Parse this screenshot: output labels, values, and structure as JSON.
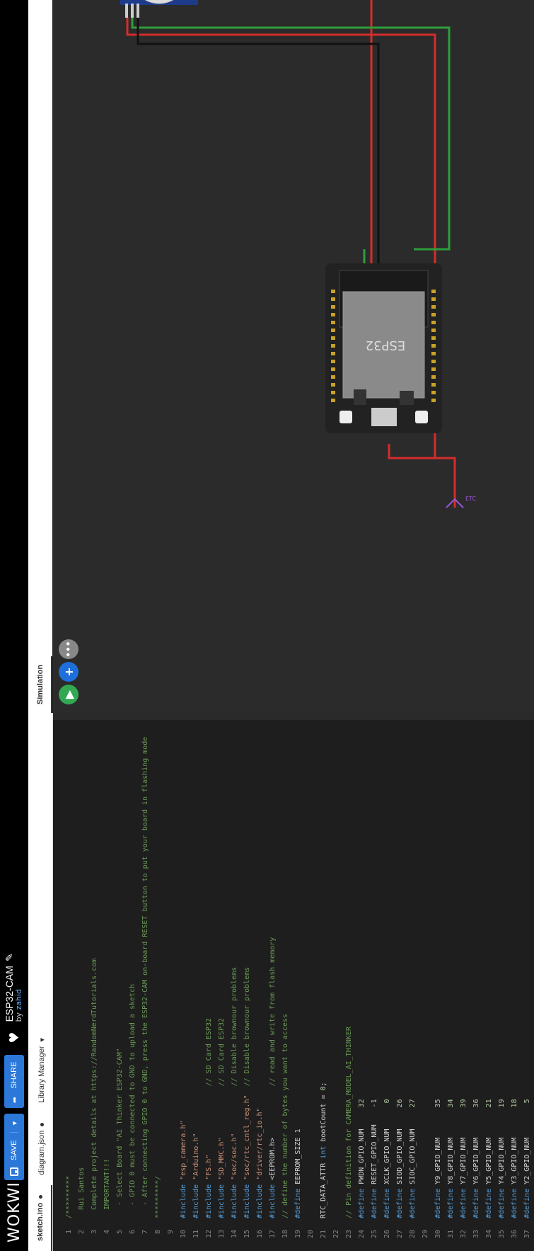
{
  "header": {
    "logo": "WOKWI",
    "save_label": "SAVE",
    "share_label": "SHARE",
    "project_title": "ESP32-CAM",
    "by_label": "by",
    "author": "zahid"
  },
  "tabs": [
    {
      "label": "sketch.ino"
    },
    {
      "label": "diagram.json"
    },
    {
      "label": "Library Manager"
    }
  ],
  "simulation_tab": "Simulation",
  "chip_label": "ESP32",
  "code_lines": [
    {
      "n": "1",
      "html": "<span class='cm'>/*********</span>"
    },
    {
      "n": "2",
      "html": "<span class='cm'>  Rui Santos</span>"
    },
    {
      "n": "3",
      "html": "<span class='cm'>  Complete project details at https://RandomNerdTutorials.com</span>"
    },
    {
      "n": "4",
      "html": "<span class='cm'>  IMPORTANT!!!</span>"
    },
    {
      "n": "5",
      "html": "<span class='cm'>   - Select Board \"AI Thinker ESP32-CAM\"</span>"
    },
    {
      "n": "6",
      "html": "<span class='cm'>   - GPIO 0 must be connected to GND to upload a sketch</span>"
    },
    {
      "n": "7",
      "html": "<span class='cm'>   - After connecting GPIO 0 to GND, press the ESP32-CAM on-board RESET button to put your board in flashing mode</span>"
    },
    {
      "n": "8",
      "html": "<span class='cm'>*********/</span>"
    },
    {
      "n": "9",
      "html": ""
    },
    {
      "n": "10",
      "html": "<span class='kw'>#include</span> <span class='str'>\"esp_camera.h\"</span>"
    },
    {
      "n": "11",
      "html": "<span class='kw'>#include</span> <span class='str'>\"Arduino.h\"</span>"
    },
    {
      "n": "12",
      "html": "<span class='kw'>#include</span> <span class='str'>\"FS.h\"</span>                <span class='cm'>// SD Card ESP32</span>"
    },
    {
      "n": "13",
      "html": "<span class='kw'>#include</span> <span class='str'>\"SD_MMC.h\"</span>            <span class='cm'>// SD Card ESP32</span>"
    },
    {
      "n": "14",
      "html": "<span class='kw'>#include</span> <span class='str'>\"soc/soc.h\"</span>           <span class='cm'>// Disable brownour problems</span>"
    },
    {
      "n": "15",
      "html": "<span class='kw'>#include</span> <span class='str'>\"soc/rtc_cntl_reg.h\"</span>  <span class='cm'>// Disable brownour problems</span>"
    },
    {
      "n": "16",
      "html": "<span class='kw'>#include</span> <span class='str'>\"driver/rtc_io.h\"</span>"
    },
    {
      "n": "17",
      "html": "<span class='kw'>#include</span> <span class='tx'>&lt;EEPROM.h&gt;</span>            <span class='cm'>// read and write from flash memory</span>"
    },
    {
      "n": "18",
      "html": "<span class='cm'>// define the number of bytes you want to access</span>"
    },
    {
      "n": "19",
      "html": "<span class='kw'>#define</span> <span class='tx'>EEPROM_SIZE</span> <span class='nm'>1</span>"
    },
    {
      "n": "20",
      "html": ""
    },
    {
      "n": "21",
      "html": "<span class='tx'>RTC_DATA_ATTR </span><span class='kw'>int</span><span class='tx'> bootCount = </span><span class='nm'>0</span><span class='tx'>;</span>"
    },
    {
      "n": "22",
      "html": ""
    },
    {
      "n": "23",
      "html": "<span class='cm'>// Pin definition for CAMERA_MODEL_AI_THINKER</span>"
    },
    {
      "n": "24",
      "html": "<span class='kw'>#define</span> <span class='tx'>PWDN_GPIO_NUM     </span><span class='nm'>32</span>"
    },
    {
      "n": "25",
      "html": "<span class='kw'>#define</span> <span class='tx'>RESET_GPIO_NUM    </span><span class='nm'>-1</span>"
    },
    {
      "n": "26",
      "html": "<span class='kw'>#define</span> <span class='tx'>XCLK_GPIO_NUM      </span><span class='nm'>0</span>"
    },
    {
      "n": "27",
      "html": "<span class='kw'>#define</span> <span class='tx'>SIOD_GPIO_NUM     </span><span class='nm'>26</span>"
    },
    {
      "n": "28",
      "html": "<span class='kw'>#define</span> <span class='tx'>SIOC_GPIO_NUM     </span><span class='nm'>27</span>"
    },
    {
      "n": "29",
      "html": ""
    },
    {
      "n": "30",
      "html": "<span class='kw'>#define</span> <span class='tx'>Y9_GPIO_NUM       </span><span class='nm'>35</span>"
    },
    {
      "n": "31",
      "html": "<span class='kw'>#define</span> <span class='tx'>Y8_GPIO_NUM       </span><span class='nm'>34</span>"
    },
    {
      "n": "32",
      "html": "<span class='kw'>#define</span> <span class='tx'>Y7_GPIO_NUM       </span><span class='nm'>39</span>"
    },
    {
      "n": "33",
      "html": "<span class='kw'>#define</span> <span class='tx'>Y6_GPIO_NUM       </span><span class='nm'>36</span>"
    },
    {
      "n": "34",
      "html": "<span class='kw'>#define</span> <span class='tx'>Y5_GPIO_NUM       </span><span class='nm'>21</span>"
    },
    {
      "n": "35",
      "html": "<span class='kw'>#define</span> <span class='tx'>Y4_GPIO_NUM       </span><span class='nm'>19</span>"
    },
    {
      "n": "36",
      "html": "<span class='kw'>#define</span> <span class='tx'>Y3_GPIO_NUM       </span><span class='nm'>18</span>"
    },
    {
      "n": "37",
      "html": "<span class='kw'>#define</span> <span class='tx'>Y2_GPIO_NUM        </span><span class='nm'>5</span>"
    }
  ],
  "colors": {
    "header_bg": "#000000",
    "button_blue": "#2b78d8",
    "editor_bg": "#1e1e1e",
    "sim_bg": "#2b2b2b",
    "wire_red": "#d42c2c",
    "wire_green": "#2f9e3a",
    "wire_black": "#111111",
    "board": "#222222",
    "play_green": "#32a852"
  }
}
